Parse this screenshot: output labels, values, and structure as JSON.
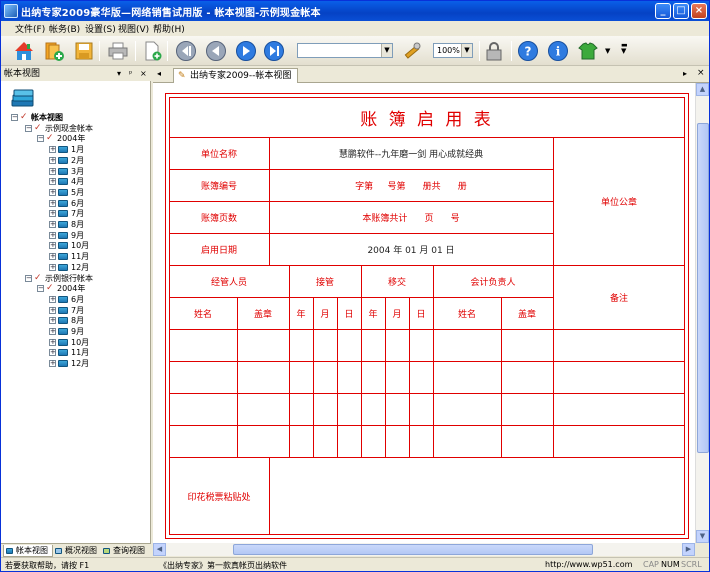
{
  "window": {
    "title": "出纳专家2009豪华版—网络销售试用版 - 帐本视图-示例现金帐本",
    "controls": [
      "_",
      "□",
      "×"
    ]
  },
  "menu": [
    "文件(F)",
    "帐务(B)",
    "设置(S)",
    "视图(V)",
    "帮助(H)"
  ],
  "toolbar": {
    "zoom": "100%",
    "page_combo": ""
  },
  "left_panel": {
    "title": "帐本视图",
    "controls": [
      "▾",
      "ᵖ",
      "×"
    ],
    "tree": {
      "root": "帐本视图",
      "books": [
        {
          "name": "示例现金帐本",
          "year": "2004年",
          "months": [
            "1月",
            "2月",
            "3月",
            "4月",
            "5月",
            "6月",
            "7月",
            "8月",
            "9月",
            "10月",
            "11月",
            "12月"
          ]
        },
        {
          "name": "示例银行帐本",
          "year": "2004年",
          "months": [
            "6月",
            "7月",
            "8月",
            "9月",
            "10月",
            "11月",
            "12月"
          ]
        }
      ]
    },
    "tabs": [
      "帐本视图",
      "概况视图",
      "查询视图"
    ]
  },
  "doc_tab": "出纳专家2009--帐本视图",
  "form": {
    "title": "账 簿 启 用 表",
    "unit_name_label": "单位名称",
    "unit_name_value": "慧鹏软件--九年磨一剑 用心成就经典",
    "book_no_label": "账簿编号",
    "book_no_value": "字第     号第      册共      册",
    "pages_label": "账簿页数",
    "pages_value": "本账簿共计      页      号",
    "start_date_label": "启用日期",
    "start_date_value": "2004 年 01 月 01 日",
    "seal_label": "单位公章",
    "staff_label": "经管人员",
    "take_over_label": "接管",
    "hand_over_label": "移交",
    "accountant_label": "会计负责人",
    "remark_label": "备注",
    "name_label": "姓名",
    "stamp_label": "盖章",
    "year_label": "年",
    "month_label": "月",
    "day_label": "日",
    "tax_stamp_label": "印花税票粘贴处"
  },
  "status": {
    "help": "若要获取帮助，请按 F1",
    "slogan": "《出纳专家》第一款真帐页出纳软件",
    "url": "http://www.wp51.com",
    "indicators": [
      "CAP",
      "NUM",
      "SCRL"
    ]
  }
}
